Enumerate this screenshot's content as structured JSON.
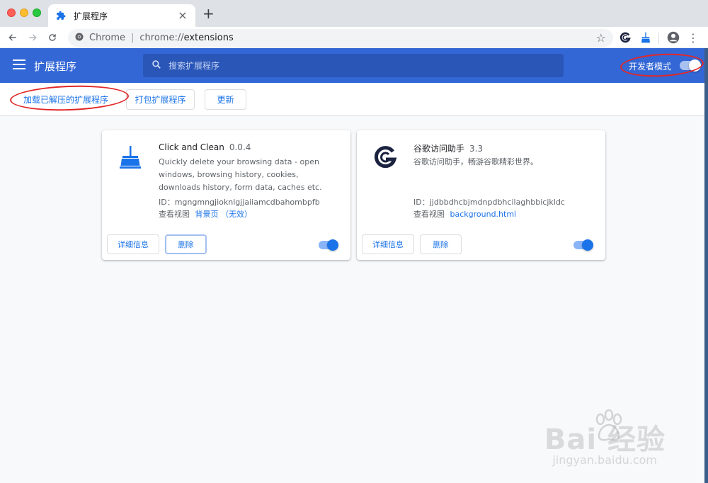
{
  "browser": {
    "tab_title": "扩展程序",
    "tab_close": "×",
    "new_tab": "+",
    "site_name": "Chrome",
    "url_separator": "|",
    "url_scheme": "chrome://",
    "url_path": "extensions",
    "bookmark_star": "☆",
    "menu_dots": "⋮"
  },
  "header": {
    "title": "扩展程序",
    "search_placeholder": "搜索扩展程序",
    "dev_mode_label": "开发者模式",
    "dev_mode_on": true
  },
  "subbar": {
    "load_unpacked": "加载已解压的扩展程序",
    "pack": "打包扩展程序",
    "update": "更新"
  },
  "extensions": [
    {
      "name": "Click and Clean",
      "version": "0.0.4",
      "description": "Quickly delete your browsing data - open windows, browsing history, cookies, downloads history, form data, caches etc.",
      "id_label": "ID：",
      "id": "mgngmngjioknlgjjaiiamcdbahombpfb",
      "views_label": "查看视图",
      "views_link": "背景页",
      "views_extra": "（无效）",
      "details_btn": "详细信息",
      "remove_btn": "删除",
      "enabled": true,
      "icon": "broom-icon"
    },
    {
      "name": "谷歌访问助手",
      "version": "3.3",
      "description": "谷歌访问助手，畅游谷歌精彩世界。",
      "id_label": "ID：",
      "id": "jjdbbdhcbjmdnpdbhcilaghbbicjkldc",
      "views_label": "查看视图",
      "views_link": "background.html",
      "details_btn": "详细信息",
      "remove_btn": "删除",
      "enabled": true,
      "icon": "google-helper-icon"
    }
  ],
  "watermark": {
    "brand": "Bai  经验",
    "url": "jingyan.baidu.com"
  },
  "colors": {
    "header_blue": "#3367d6",
    "accent_blue": "#1a73e8",
    "annotation_red": "#e02828"
  }
}
